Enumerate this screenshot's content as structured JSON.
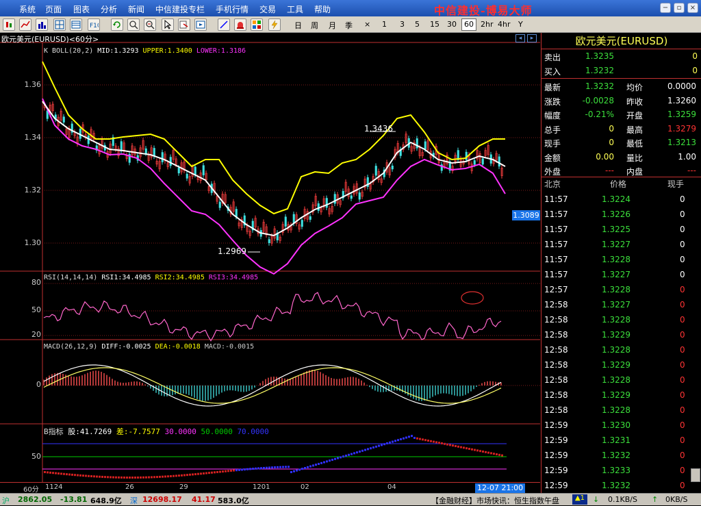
{
  "menu": [
    "系统",
    "页面",
    "图表",
    "分析",
    "新闻",
    "中信建投专栏",
    "手机行情",
    "交易",
    "工具",
    "帮助"
  ],
  "brand": "中信建投-博易大师",
  "periods": [
    "日",
    "周",
    "月",
    "季",
    "×",
    "1",
    "3",
    "5",
    "15",
    "30",
    "60",
    "2hr",
    "4hr",
    "Y"
  ],
  "chart": {
    "title": "欧元美元(EURUSD)<60分>",
    "boll": {
      "name": "K BOLL(20,2)",
      "mid": "MID:1.3293",
      "upper": "UPPER:1.3400",
      "lower": "LOWER:1.3186"
    },
    "price_axis": [
      "1.36",
      "1.34",
      "1.32",
      "1.30"
    ],
    "high_label": "1.3436",
    "low_label": "1.2969",
    "cur_price": "1.3089",
    "rsi": {
      "name": "RSI(14,14,14)",
      "r1": "RSI1:34.4985",
      "r2": "RSI2:34.4985",
      "r3": "RSI3:34.4985",
      "axis": [
        "80",
        "50",
        "20"
      ]
    },
    "macd": {
      "name": "MACD(26,12,9)",
      "diff": "DIFF:-0.0025",
      "dea": "DEA:-0.0018",
      "macd": "MACD:-0.0015",
      "axis": [
        "0"
      ]
    },
    "b": {
      "name": "B指标",
      "gu": "股:41.7269",
      "cha": "差:-7.7577",
      "l1": "30.0000",
      "l2": "50.0000",
      "l3": "70.0000",
      "axis": [
        "50"
      ]
    },
    "xaxis": {
      "period": "60分",
      "dates": [
        "1124",
        "26",
        "29",
        "1201",
        "02",
        "04"
      ],
      "cursor": "12-07 21:00"
    }
  },
  "quote": {
    "title": "欧元美元(EURUSD)",
    "sell": {
      "label": "卖出",
      "price": "1.3235",
      "vol": "0"
    },
    "buy": {
      "label": "买入",
      "price": "1.3232",
      "vol": "0"
    },
    "rows": [
      [
        "最新",
        "1.3232",
        "均价",
        "0.0000"
      ],
      [
        "涨跌",
        "-0.0028",
        "昨收",
        "1.3260"
      ],
      [
        "幅度",
        "-0.21%",
        "开盘",
        "1.3259"
      ],
      [
        "总手",
        "0",
        "最高",
        "1.3279"
      ],
      [
        "现手",
        "0",
        "最低",
        "1.3213"
      ],
      [
        "金额",
        "0.00",
        "量比",
        "1.00"
      ],
      [
        "外盘",
        "---",
        "内盘",
        "---"
      ]
    ],
    "ticks_header": [
      "北京",
      "价格",
      "现手"
    ],
    "ticks": [
      [
        "11:57",
        "1.3224",
        "0"
      ],
      [
        "11:57",
        "1.3226",
        "0"
      ],
      [
        "11:57",
        "1.3225",
        "0"
      ],
      [
        "11:57",
        "1.3227",
        "0"
      ],
      [
        "11:57",
        "1.3228",
        "0"
      ],
      [
        "11:57",
        "1.3227",
        "0"
      ],
      [
        "12:57",
        "1.3228",
        "0"
      ],
      [
        "12:58",
        "1.3227",
        "0"
      ],
      [
        "12:58",
        "1.3228",
        "0"
      ],
      [
        "12:58",
        "1.3229",
        "0"
      ],
      [
        "12:58",
        "1.3228",
        "0"
      ],
      [
        "12:58",
        "1.3229",
        "0"
      ],
      [
        "12:58",
        "1.3228",
        "0"
      ],
      [
        "12:58",
        "1.3229",
        "0"
      ],
      [
        "12:58",
        "1.3228",
        "0"
      ],
      [
        "12:59",
        "1.3230",
        "0"
      ],
      [
        "12:59",
        "1.3231",
        "0"
      ],
      [
        "12:59",
        "1.3232",
        "0"
      ],
      [
        "12:59",
        "1.3233",
        "0"
      ],
      [
        "12:59",
        "1.3232",
        "0"
      ]
    ]
  },
  "status": {
    "sh": "沪",
    "sh_idx": "2862.05",
    "sh_chg": "-13.81",
    "sh_amt": "648.9亿",
    "sz": "深",
    "sz_idx": "12698.17",
    "sz_chg": "41.17",
    "sz_amt": "583.0亿",
    "news": "【金融财经】市场快讯：恒生指数午盘",
    "speed1": "0.1KB/S",
    "speed2": "0KB/S"
  }
}
